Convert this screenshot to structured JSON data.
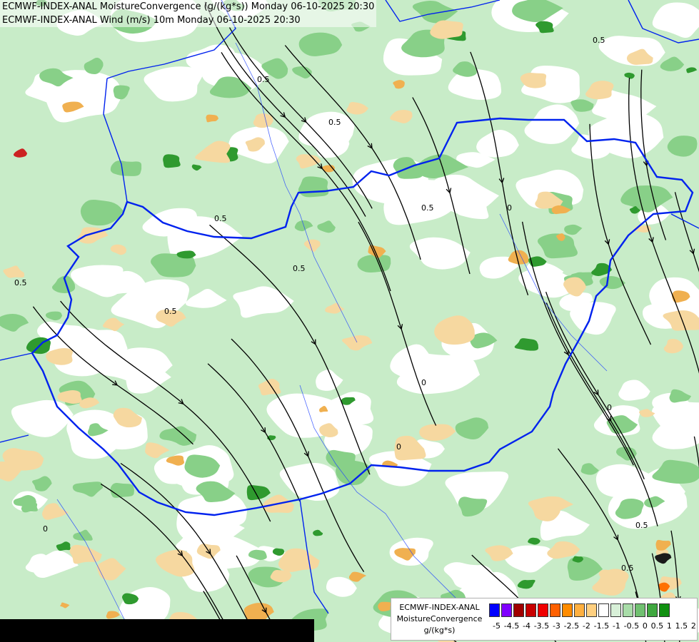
{
  "map_title": {
    "line1": "ECMWF-INDEX-ANAL MoistureConvergence (g/(kg*s)) Monday 06-10-2025 20:30",
    "line2": "ECMWF-INDEX-ANAL Wind (m/s) 10m Monday 06-10-2025 20:30"
  },
  "contour_labels": [
    "0.5",
    "0.5",
    "0.5",
    "0.5",
    "0.5",
    "0.5",
    "0.5",
    "0.5",
    "0",
    "0",
    "0",
    "0",
    "0.5",
    "0.5",
    "0"
  ],
  "legend": {
    "line1": "ECMWF-INDEX-ANAL",
    "line2": "MoistureConvergence",
    "line3": "g/(kg*s)",
    "colors": [
      "#0000ff",
      "#8000ff",
      "#a00000",
      "#c80000",
      "#f00000",
      "#ff6000",
      "#ff8c00",
      "#ffb040",
      "#ffd080",
      "#ffffff",
      "#d8f0d8",
      "#a8dca8",
      "#70c070",
      "#40a840",
      "#109010"
    ],
    "ticks": [
      "-5",
      "-4.5",
      "-4",
      "-3.5",
      "-3",
      "-2.5",
      "-2",
      "-1.5",
      "-1",
      "-0.5",
      "0",
      "0.5",
      "1",
      "1.5",
      "2"
    ]
  },
  "colors": {
    "border": "#0022ee",
    "river": "#2244ff",
    "streamline": "#000000",
    "positive_light": "#c8ecc8",
    "positive_mid": "#88d088",
    "positive_strong": "#2f9a2f",
    "negative_light": "#f6d8a0",
    "negative_mid": "#f0b050",
    "negative_strong": "#cc2222"
  }
}
